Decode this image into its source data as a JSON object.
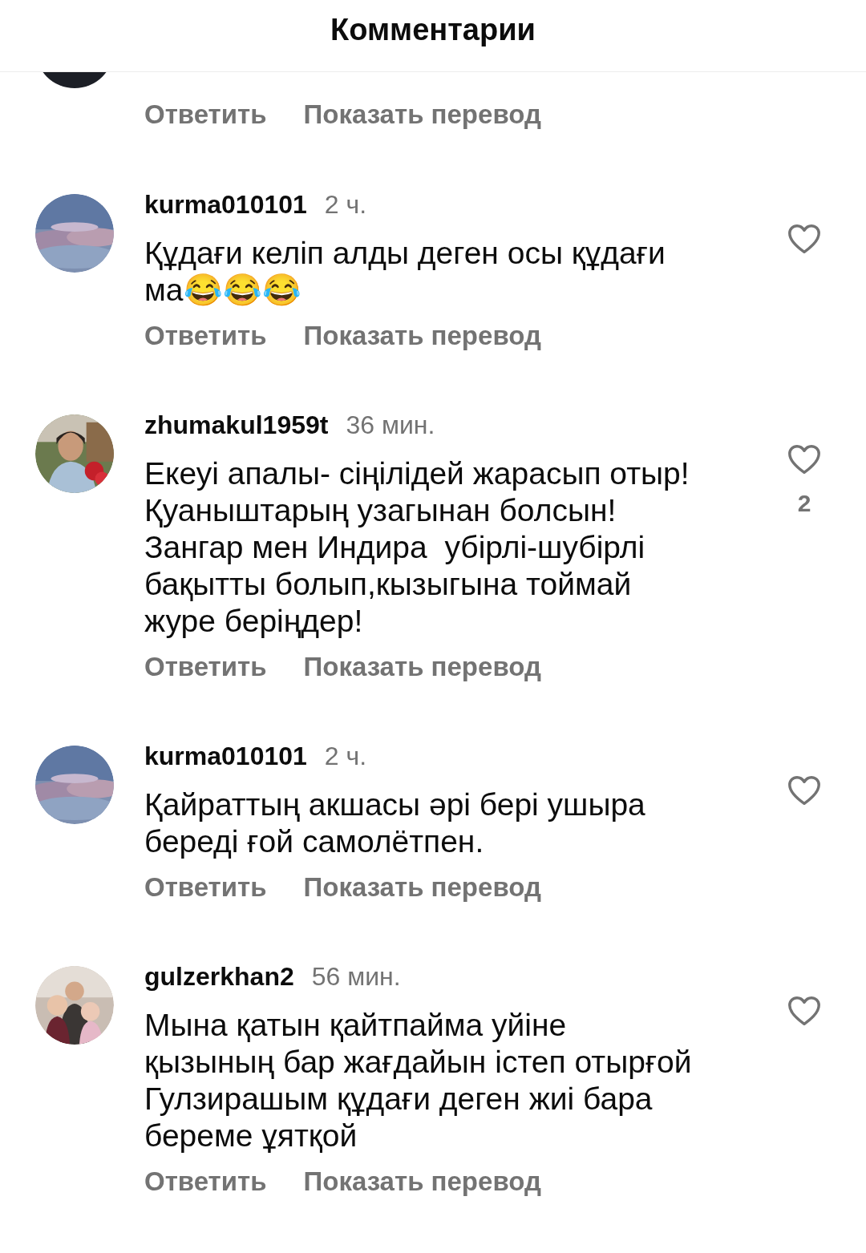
{
  "header": {
    "title": "Комментарии"
  },
  "partial_comment": {
    "actions": [
      "Ответить",
      "Показать перевод"
    ]
  },
  "comments": [
    {
      "username": "kurma010101",
      "time": "2 ч.",
      "lines": [
        "Құдағи келіп алды деген осы құдағи",
        "ма😂😂😂"
      ],
      "liked": false,
      "actions": [
        "Ответить",
        "Показать перевод"
      ]
    },
    {
      "username": "zhumakul1959t",
      "time": "36 мин.",
      "lines": [
        "Екеуі апалы- сіңілідей жарасып отыр!",
        "Қуаныштарың узагынан болсын!",
        "Зангар мен Индира  убірлі-шубірлі",
        "бақытты болып,кызыгына тоймай",
        "журе беріңдер!"
      ],
      "liked": false,
      "like_count": "2",
      "actions": [
        "Ответить",
        "Показать перевод"
      ]
    },
    {
      "username": "kurma010101",
      "time": "2 ч.",
      "lines": [
        "Қайраттың акшасы әрі бері ушыра",
        "береді ғой самолётпен."
      ],
      "liked": false,
      "actions": [
        "Ответить",
        "Показать перевод"
      ]
    },
    {
      "username": "gulzerkhan2",
      "time": "56 мин.",
      "lines": [
        "Мына қатын қайтпайма уйіне",
        "қызының бар жағдайын істеп отырғой",
        "Гулзирашым құдағи деген жиі бара",
        "береме ұятқой"
      ],
      "liked": false,
      "actions": [
        "Ответить",
        "Показать перевод"
      ]
    }
  ]
}
